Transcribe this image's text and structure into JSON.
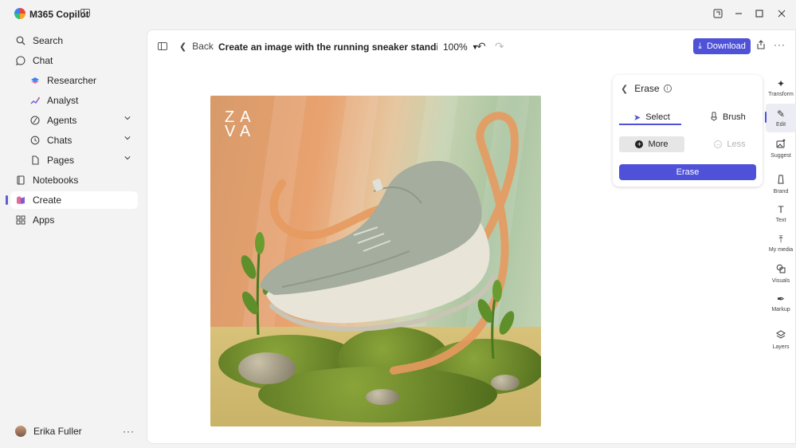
{
  "app": {
    "title": "M365 Copilot"
  },
  "window": {
    "restore_icon": "restore-icon",
    "minimize_icon": "minimize-icon",
    "maximize_icon": "maximize-icon",
    "close_icon": "close-icon"
  },
  "nav": {
    "search": "Search",
    "chat": "Chat",
    "researcher": "Researcher",
    "analyst": "Analyst",
    "agents": "Agents",
    "chats": "Chats",
    "pages": "Pages",
    "notebooks": "Notebooks",
    "create": "Create",
    "apps": "Apps"
  },
  "user": {
    "name": "Erika Fuller",
    "more": "···"
  },
  "toolbar": {
    "back": "Back",
    "title": "Create an image with the running sneaker standing upright in a mo..",
    "zoom": "100%",
    "download": "Download"
  },
  "canvas": {
    "logo_line1": "ZA",
    "logo_line2": "VA"
  },
  "erase_panel": {
    "title": "Erase",
    "tab_select": "Select",
    "tab_brush": "Brush",
    "more": "More",
    "less": "Less",
    "erase_button": "Erase"
  },
  "rail": {
    "transform": "Transform",
    "edit": "Edit",
    "suggest": "Suggest",
    "brand": "Brand",
    "text": "Text",
    "my_media": "My media",
    "visuals": "Visuals",
    "markup": "Markup",
    "layers": "Layers"
  },
  "colors": {
    "accent": "#4f52d8",
    "nav_accent": "#5b5fc7"
  }
}
